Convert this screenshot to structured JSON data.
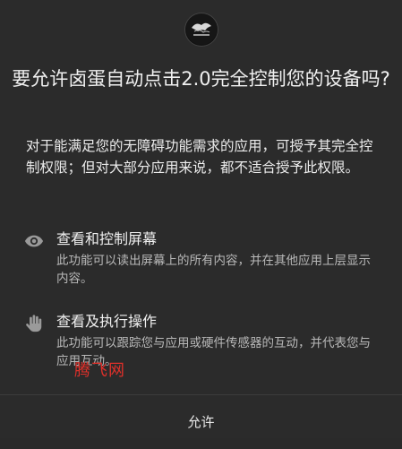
{
  "dialog": {
    "title": "要允许卤蛋自动点击2.0完全控制您的设备吗?",
    "description": "对于能满足您的无障碍功能需求的应用，可授予其完全控制权限；但对大部分应用来说，都不适合授予此权限。",
    "permissions": [
      {
        "icon": "eye-icon",
        "title": "查看和控制屏幕",
        "description": "此功能可以读出屏幕上的所有内容，并在其他应用上层显示内容。"
      },
      {
        "icon": "hand-icon",
        "title": "查看及执行操作",
        "description": "此功能可以跟踪您与应用或硬件传感器的互动，并代表您与应用互动。"
      }
    ],
    "allow_label": "允许"
  },
  "watermark": "腾飞网",
  "colors": {
    "background": "#2b2b2b",
    "primary_text": "#f0f0f0",
    "secondary_text": "#b8b8b8",
    "watermark": "#e0302a"
  }
}
